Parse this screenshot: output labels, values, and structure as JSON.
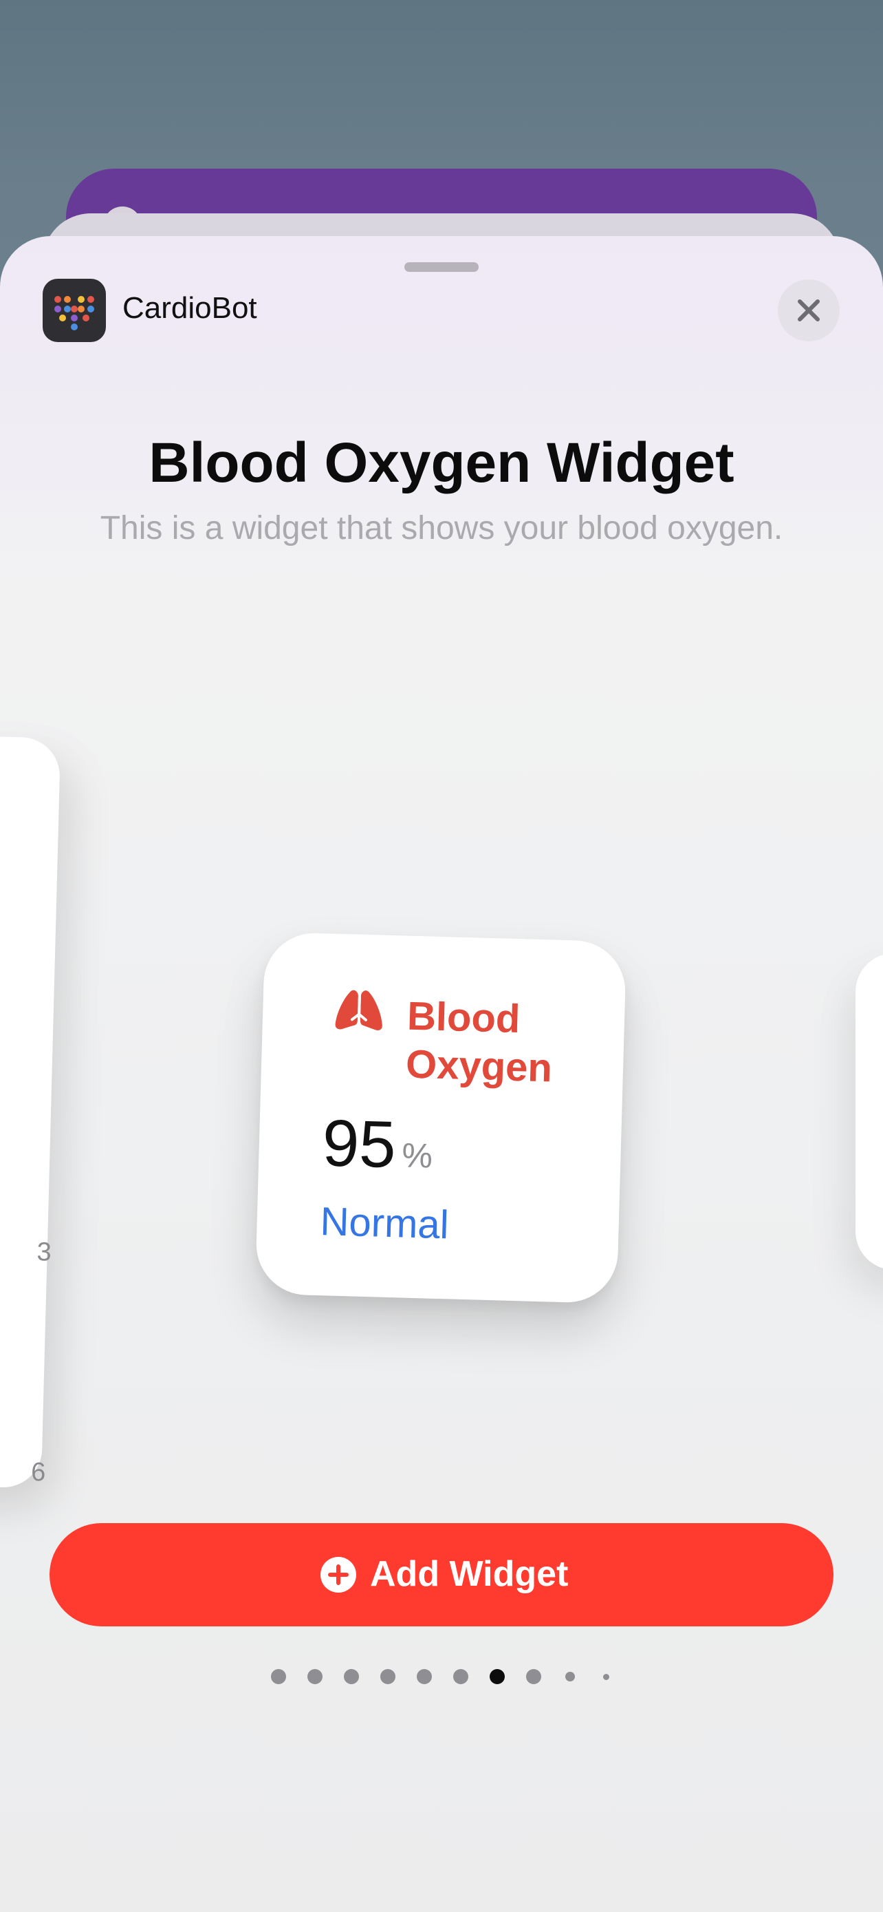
{
  "app": {
    "name": "CardioBot",
    "icon": "dot-grid-heart-icon"
  },
  "sheet": {
    "title": "Blood Oxygen Widget",
    "subtitle": "This is a widget that shows your blood oxygen."
  },
  "left_widget_partial": {
    "label_a": "3",
    "label_b": "6"
  },
  "widget": {
    "icon": "lungs-icon",
    "title": "Blood Oxygen",
    "value": "95",
    "unit": "%",
    "status": "Normal",
    "accent_color": "#e14a3b",
    "status_color": "#3575e4"
  },
  "pagination": {
    "total": 10,
    "active_index": 6
  },
  "add_button": {
    "label": "Add Widget",
    "icon": "plus-circle-icon",
    "color": "#ff3b30"
  },
  "close_button": {
    "icon": "close-icon"
  }
}
